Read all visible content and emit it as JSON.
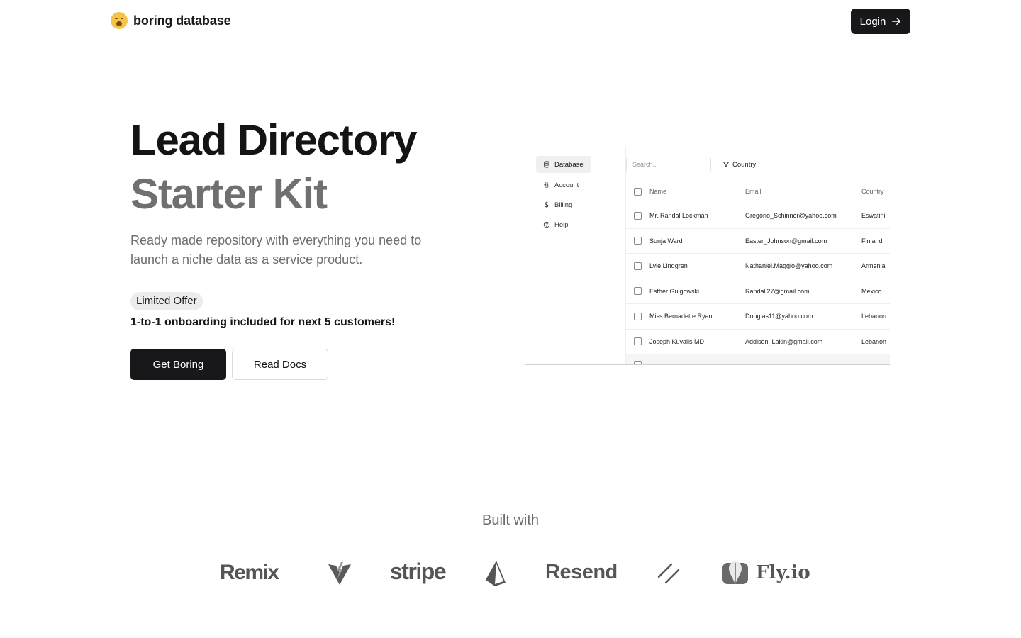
{
  "header": {
    "brand_name": "boring database",
    "login_label": "Login"
  },
  "hero": {
    "title_line1": "Lead Directory",
    "title_line2": "Starter Kit",
    "subtitle": "Ready made repository with everything you need to launch a niche data as a service product.",
    "badge": "Limited Offer",
    "offer_text": "1-to-1 onboarding included for next 5 customers!",
    "primary_button": "Get Boring",
    "secondary_button": "Read Docs"
  },
  "preview": {
    "sidebar": [
      {
        "label": "Database",
        "icon": "database-icon",
        "active": true
      },
      {
        "label": "Account",
        "icon": "gear-icon",
        "active": false
      },
      {
        "label": "Billing",
        "icon": "dollar-icon",
        "active": false
      },
      {
        "label": "Help",
        "icon": "help-circle-icon",
        "active": false
      }
    ],
    "search_placeholder": "Search...",
    "filter_label": "Country",
    "columns": [
      "Name",
      "Email",
      "Country"
    ],
    "rows": [
      {
        "name": "Mr. Randal Lockman",
        "email": "Gregorio_Schinner@yahoo.com",
        "country": "Eswatini"
      },
      {
        "name": "Sonja Ward",
        "email": "Easter_Johnson@gmail.com",
        "country": "Finland"
      },
      {
        "name": "Lyle Lindgren",
        "email": "Nathaniel.Maggio@yahoo.com",
        "country": "Armenia"
      },
      {
        "name": "Esther Gulgowski",
        "email": "Randall27@gmail.com",
        "country": "Mexico"
      },
      {
        "name": "Miss Bernadette Ryan",
        "email": "Douglas11@yahoo.com",
        "country": "Lebanon"
      },
      {
        "name": "Joseph Kuvalis MD",
        "email": "Addison_Lakin@gmail.com",
        "country": "Lebanon"
      }
    ]
  },
  "built_with": {
    "title": "Built with",
    "logos": [
      "Remix",
      "Vite",
      "stripe",
      "Prisma",
      "Resend",
      "Shadcn",
      "Fly.io"
    ]
  }
}
